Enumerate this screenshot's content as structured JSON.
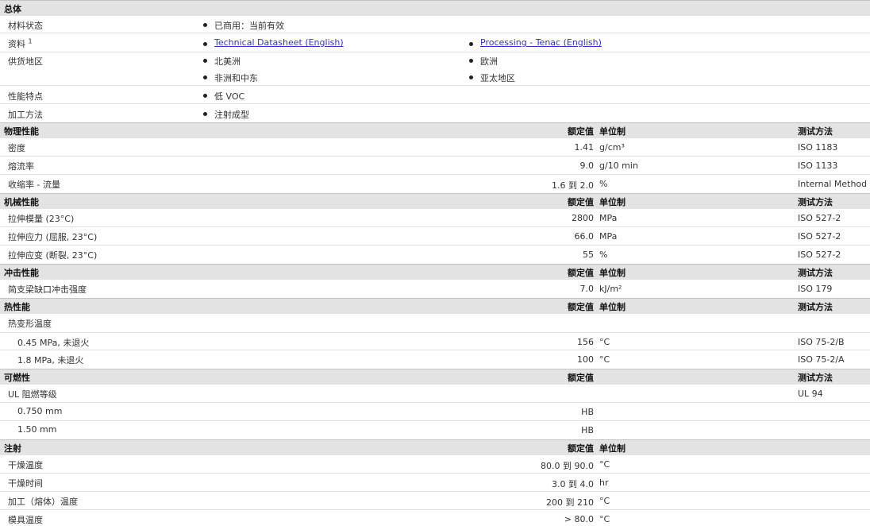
{
  "general": {
    "section_title": "总体",
    "rows": [
      {
        "label": "材料状态",
        "items": [
          "已商用：当前有效"
        ]
      },
      {
        "label": "资料",
        "sup": "1",
        "links": [
          "Technical Datasheet (English)",
          "Processing - Tenac (English)"
        ]
      },
      {
        "label": "供货地区",
        "items": [
          "北美洲",
          "欧洲",
          "非洲和中东",
          "亚太地区"
        ]
      },
      {
        "label": "性能特点",
        "items": [
          "低 VOC"
        ]
      },
      {
        "label": "加工方法",
        "items": [
          "注射成型"
        ]
      }
    ]
  },
  "headers": {
    "nominal": "额定值",
    "unit": "单位制",
    "method": "测试方法"
  },
  "physical": {
    "section_title": "物理性能",
    "rows": [
      {
        "label": "密度",
        "value": "1.41",
        "unit": "g/cm³",
        "method": "ISO 1183"
      },
      {
        "label": "熔流率",
        "value": "9.0",
        "unit": "g/10 min",
        "method": "ISO 1133"
      },
      {
        "label": "收缩率 - 流量",
        "value": "1.6 到  2.0",
        "unit": "%",
        "method": "Internal Method"
      }
    ]
  },
  "mechanical": {
    "section_title": "机械性能",
    "rows": [
      {
        "label": "拉伸模量 (23°C)",
        "value": "2800",
        "unit": "MPa",
        "method": "ISO 527-2"
      },
      {
        "label": "拉伸应力 (屈服, 23°C)",
        "value": "66.0",
        "unit": "MPa",
        "method": "ISO 527-2"
      },
      {
        "label": "拉伸应变 (断裂, 23°C)",
        "value": "55",
        "unit": "%",
        "method": "ISO 527-2"
      }
    ]
  },
  "impact": {
    "section_title": "冲击性能",
    "rows": [
      {
        "label": "简支梁缺口冲击强度",
        "value": "7.0",
        "unit": "kJ/m²",
        "method": "ISO 179"
      }
    ]
  },
  "thermal": {
    "section_title": "热性能",
    "group_label": "热变形温度",
    "rows": [
      {
        "label": "0.45 MPa, 未退火",
        "value": "156",
        "unit": "°C",
        "method": "ISO 75-2/B"
      },
      {
        "label": "1.8 MPa, 未退火",
        "value": "100",
        "unit": "°C",
        "method": "ISO 75-2/A"
      }
    ]
  },
  "flammability": {
    "section_title": "可燃性",
    "group_label": "UL 阻燃等级",
    "group_method": "UL 94",
    "rows": [
      {
        "label": "0.750 mm",
        "value": "HB"
      },
      {
        "label": "1.50 mm",
        "value": "HB"
      }
    ]
  },
  "injection": {
    "section_title": "注射",
    "rows": [
      {
        "label": "干燥温度",
        "value": "80.0 到  90.0",
        "unit": "°C"
      },
      {
        "label": "干燥时间",
        "value": "3.0 到  4.0",
        "unit": "hr"
      },
      {
        "label": "加工（熔体）温度",
        "value": "200 到  210",
        "unit": "°C"
      },
      {
        "label": "模具温度",
        "value": "> 80.0",
        "unit": "°C"
      }
    ]
  }
}
